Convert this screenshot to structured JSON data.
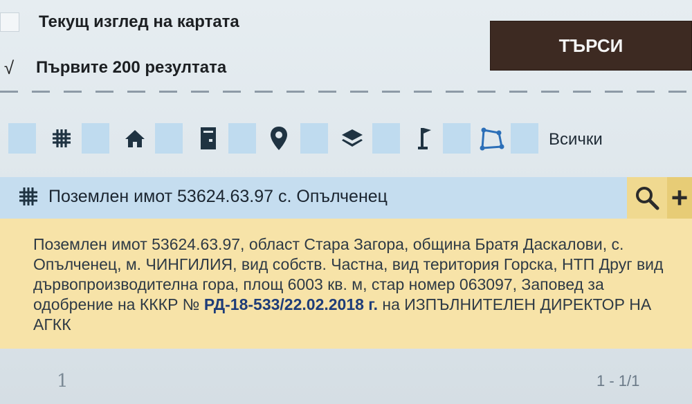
{
  "options": {
    "current_view": {
      "label": "Текущ изглед на картата",
      "checked": false
    },
    "first_200": {
      "label": "Първите 200 резултата",
      "checked": true,
      "mark": "√"
    }
  },
  "search_button": {
    "label": "ТЪРСИ",
    "color": "#3d2a22"
  },
  "filter_toolbar": {
    "icons": [
      "grid-icon",
      "home-icon",
      "building-icon",
      "map-pin-icon",
      "layers-icon",
      "flag-icon",
      "polygon-icon"
    ],
    "all_label": "Всички",
    "accent": "#bfdbef"
  },
  "result": {
    "icon": "grid-icon",
    "title": "Поземлен имот 53624.63.97 с. Опълченец",
    "details_before": "Поземлен имот 53624.63.97, област Стара Загора, община Братя Даскалови, с. Опълченец, м. ЧИНГИЛИЯ, вид собств. Частна, вид територия Горска, НТП Друг вид дървопроизводителна гора, площ 6003 кв. м, стар номер 063097, Заповед за одобрение на КККР № ",
    "details_order": "РД-18-533/22.02.2018 г.",
    "details_after": " на ИЗПЪЛНИТЕЛЕН ДИРЕКТОР НА АГКК",
    "highlight_color": "#f7e3a8"
  },
  "pagination": {
    "page": "1",
    "count": "1 - 1/1"
  }
}
